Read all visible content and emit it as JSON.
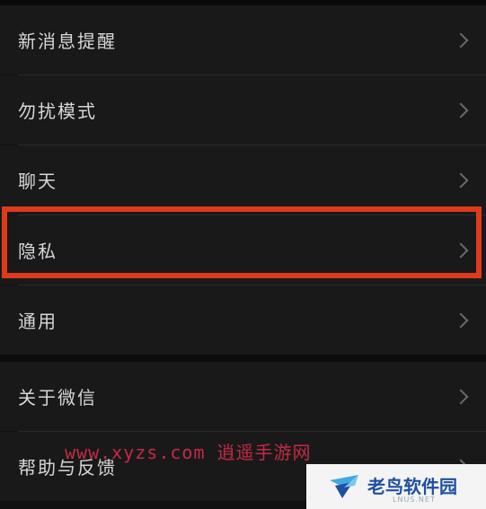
{
  "menu": {
    "items": [
      {
        "label": "新消息提醒"
      },
      {
        "label": "勿扰模式"
      },
      {
        "label": "聊天"
      },
      {
        "label": "隐私"
      },
      {
        "label": "通用"
      },
      {
        "label": "关于微信"
      },
      {
        "label": "帮助与反馈"
      }
    ]
  },
  "watermark": {
    "text": "www.xyzs.com 逍遥手游网",
    "brand_name": "老鸟软件园",
    "brand_sub": "LNUS.NET"
  },
  "colors": {
    "highlight": "#e03a1e",
    "watermark_text": "#c42a45",
    "brand": "#1f4fa0"
  }
}
